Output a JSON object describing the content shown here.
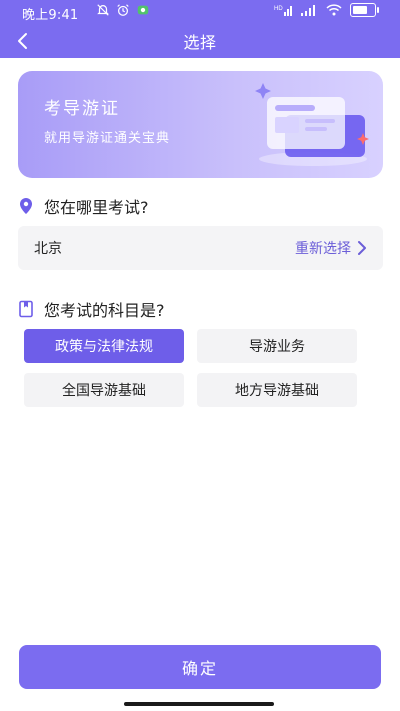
{
  "status_bar": {
    "time": "晚上9:41",
    "right_icons": [
      "signal-hd-icon",
      "signal-icon",
      "wifi-icon",
      "battery-charging-icon"
    ],
    "left_icons": [
      "mute-icon",
      "alarm-icon",
      "app-badge-icon"
    ]
  },
  "nav": {
    "title": "选择",
    "back_icon": "chevron-left-icon"
  },
  "banner": {
    "title": "考导游证",
    "subtitle": "就用导游证通关宝典"
  },
  "location_section": {
    "heading": "您在哪里考试?",
    "icon": "location-pin-icon",
    "current_value": "北京",
    "reselect_label": "重新选择"
  },
  "subject_section": {
    "heading": "您考试的科目是?",
    "icon": "book-icon",
    "options": [
      {
        "label": "政策与法律法规",
        "selected": true
      },
      {
        "label": "导游业务",
        "selected": false
      },
      {
        "label": "全国导游基础",
        "selected": false
      },
      {
        "label": "地方导游基础",
        "selected": false
      }
    ]
  },
  "confirm_label": "确定",
  "colors": {
    "accent": "#7b6cf0",
    "selected_chip": "#6e5ee9",
    "chip_bg": "#f3f3f5",
    "link": "#6b5ed8"
  }
}
